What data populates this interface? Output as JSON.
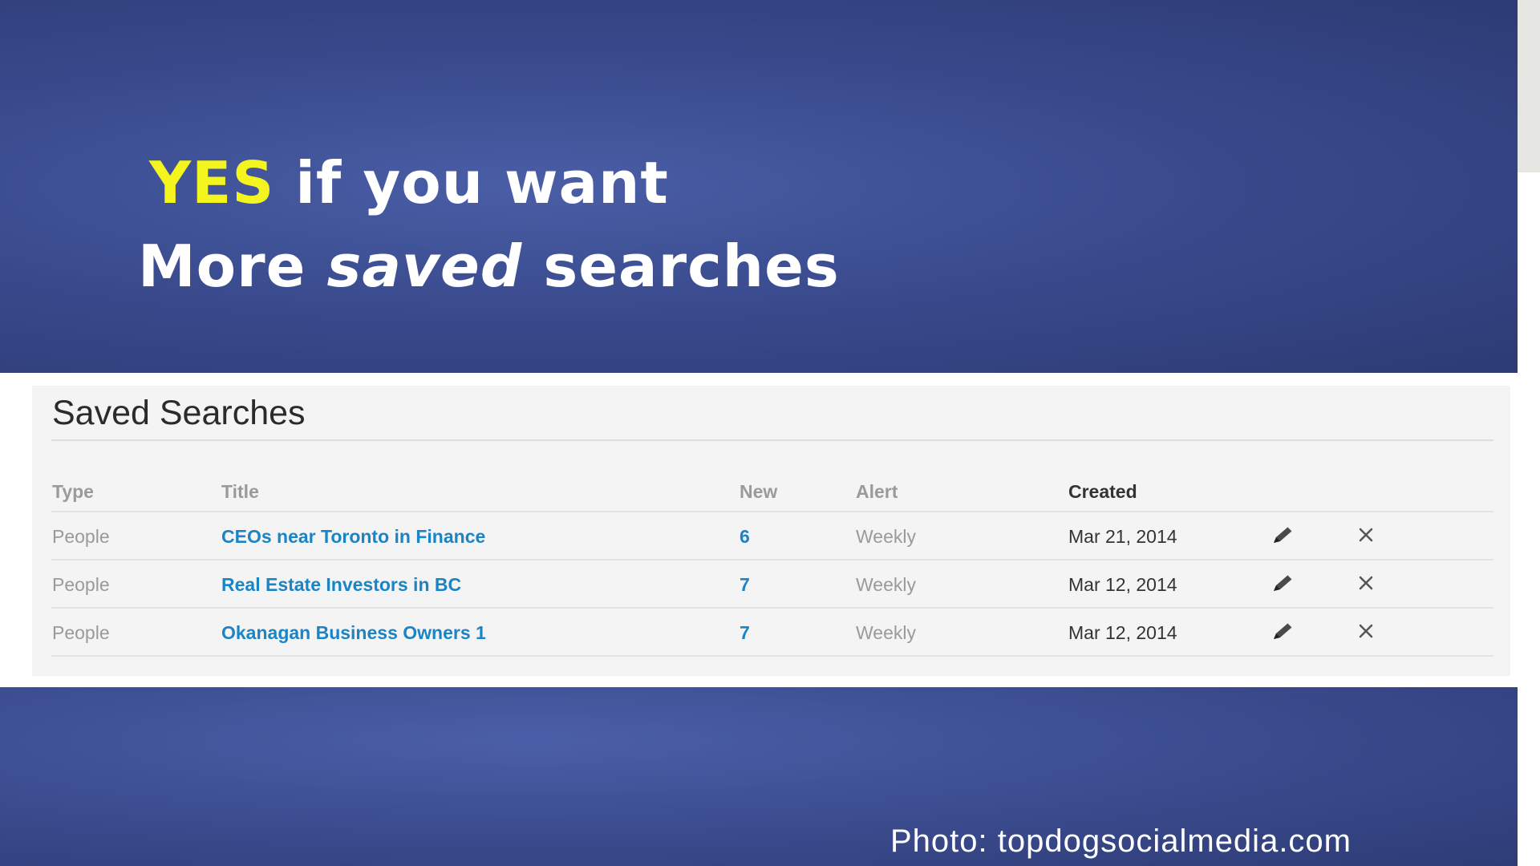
{
  "slide": {
    "headline": {
      "yes": "YES",
      "line1_rest": " if you want",
      "line2_part1": "More ",
      "line2_italic": "saved",
      "line2_part2": " searches"
    },
    "credit": "Photo: topdogsocialmedia.com"
  },
  "panel": {
    "title": "Saved Searches",
    "columns": {
      "type": "Type",
      "title": "Title",
      "new": "New",
      "alert": "Alert",
      "created": "Created"
    },
    "active_sort_column": "Created",
    "rows": [
      {
        "type": "People",
        "title": "CEOs near Toronto in Finance",
        "new": "6",
        "alert": "Weekly",
        "created": "Mar 21, 2014"
      },
      {
        "type": "People",
        "title": "Real Estate Investors in BC",
        "new": "7",
        "alert": "Weekly",
        "created": "Mar 12, 2014"
      },
      {
        "type": "People",
        "title": "Okanagan Business Owners 1",
        "new": "7",
        "alert": "Weekly",
        "created": "Mar 12, 2014"
      }
    ],
    "row_actions": {
      "edit_icon": "pencil-icon",
      "delete_icon": "close-icon"
    }
  },
  "colors": {
    "background_blue": "#3a4b8e",
    "highlight_yellow": "#f4f41e",
    "link_blue": "#1a84c4",
    "muted_text": "#9a9a9a",
    "panel_bg": "#f4f4f4"
  }
}
